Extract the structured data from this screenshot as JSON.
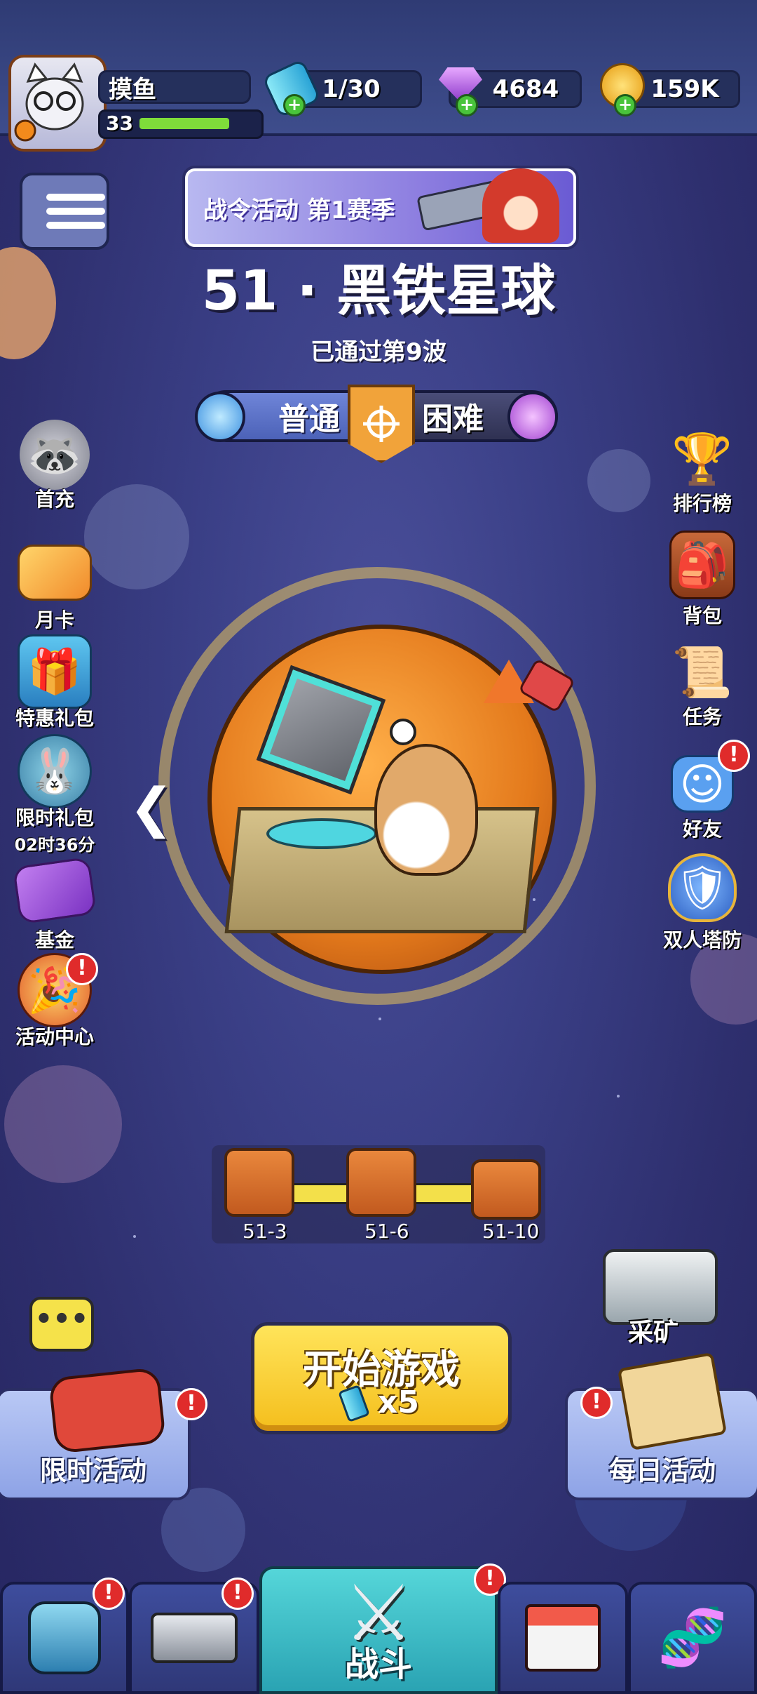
{
  "player": {
    "name": "摸鱼",
    "level": "33",
    "xp_fraction": 0.85
  },
  "resources": [
    {
      "name": "energy",
      "value": "1/30",
      "icon": "energy-battery-icon",
      "color": "#3ad0e8"
    },
    {
      "name": "gems",
      "value": "4684",
      "icon": "purple-gem-icon",
      "color": "#b55ae6"
    },
    {
      "name": "gold",
      "value": "159K",
      "icon": "gold-coin-icon",
      "color": "#f5b820"
    }
  ],
  "banner": {
    "text": "战令活动  第1赛季"
  },
  "stage": {
    "title": "51 · 黑铁星球",
    "progress_text": "已通过第9波"
  },
  "difficulty": {
    "normal": "普通",
    "hard": "困难",
    "selected": "normal"
  },
  "left_menu": [
    {
      "label": "首充",
      "icon": "raccoon-icon"
    },
    {
      "label": "月卡",
      "icon": "month-card-icon"
    },
    {
      "label": "特惠礼包",
      "icon": "gift-box-icon"
    },
    {
      "label": "限时礼包",
      "sub": "02时36分",
      "icon": "bunny-jeep-icon"
    },
    {
      "label": "基金",
      "icon": "purple-ticket-icon"
    },
    {
      "label": "活动中心",
      "icon": "party-horn-icon",
      "badge": "!"
    }
  ],
  "right_menu": [
    {
      "label": "排行榜",
      "icon": "trophy-icon"
    },
    {
      "label": "背包",
      "icon": "backpack-icon"
    },
    {
      "label": "任务",
      "icon": "scroll-icon"
    },
    {
      "label": "好友",
      "icon": "friend-face-icon",
      "badge": "!"
    },
    {
      "label": "双人塔防",
      "icon": "shield-badge-icon"
    }
  ],
  "chests": [
    {
      "label": "51-3"
    },
    {
      "label": "51-6"
    },
    {
      "label": "51-10"
    }
  ],
  "start": {
    "label": "开始游戏",
    "cost": "x5"
  },
  "mining": {
    "label": "采矿"
  },
  "panels": {
    "limited": "限时活动",
    "daily": "每日活动",
    "badge": "!"
  },
  "nav": {
    "battle": "战斗",
    "badge": "!"
  },
  "colors": {
    "accent_yellow": "#f4be1c",
    "accent_blue": "#3ad0e8",
    "alert_red": "#e02b2b"
  }
}
